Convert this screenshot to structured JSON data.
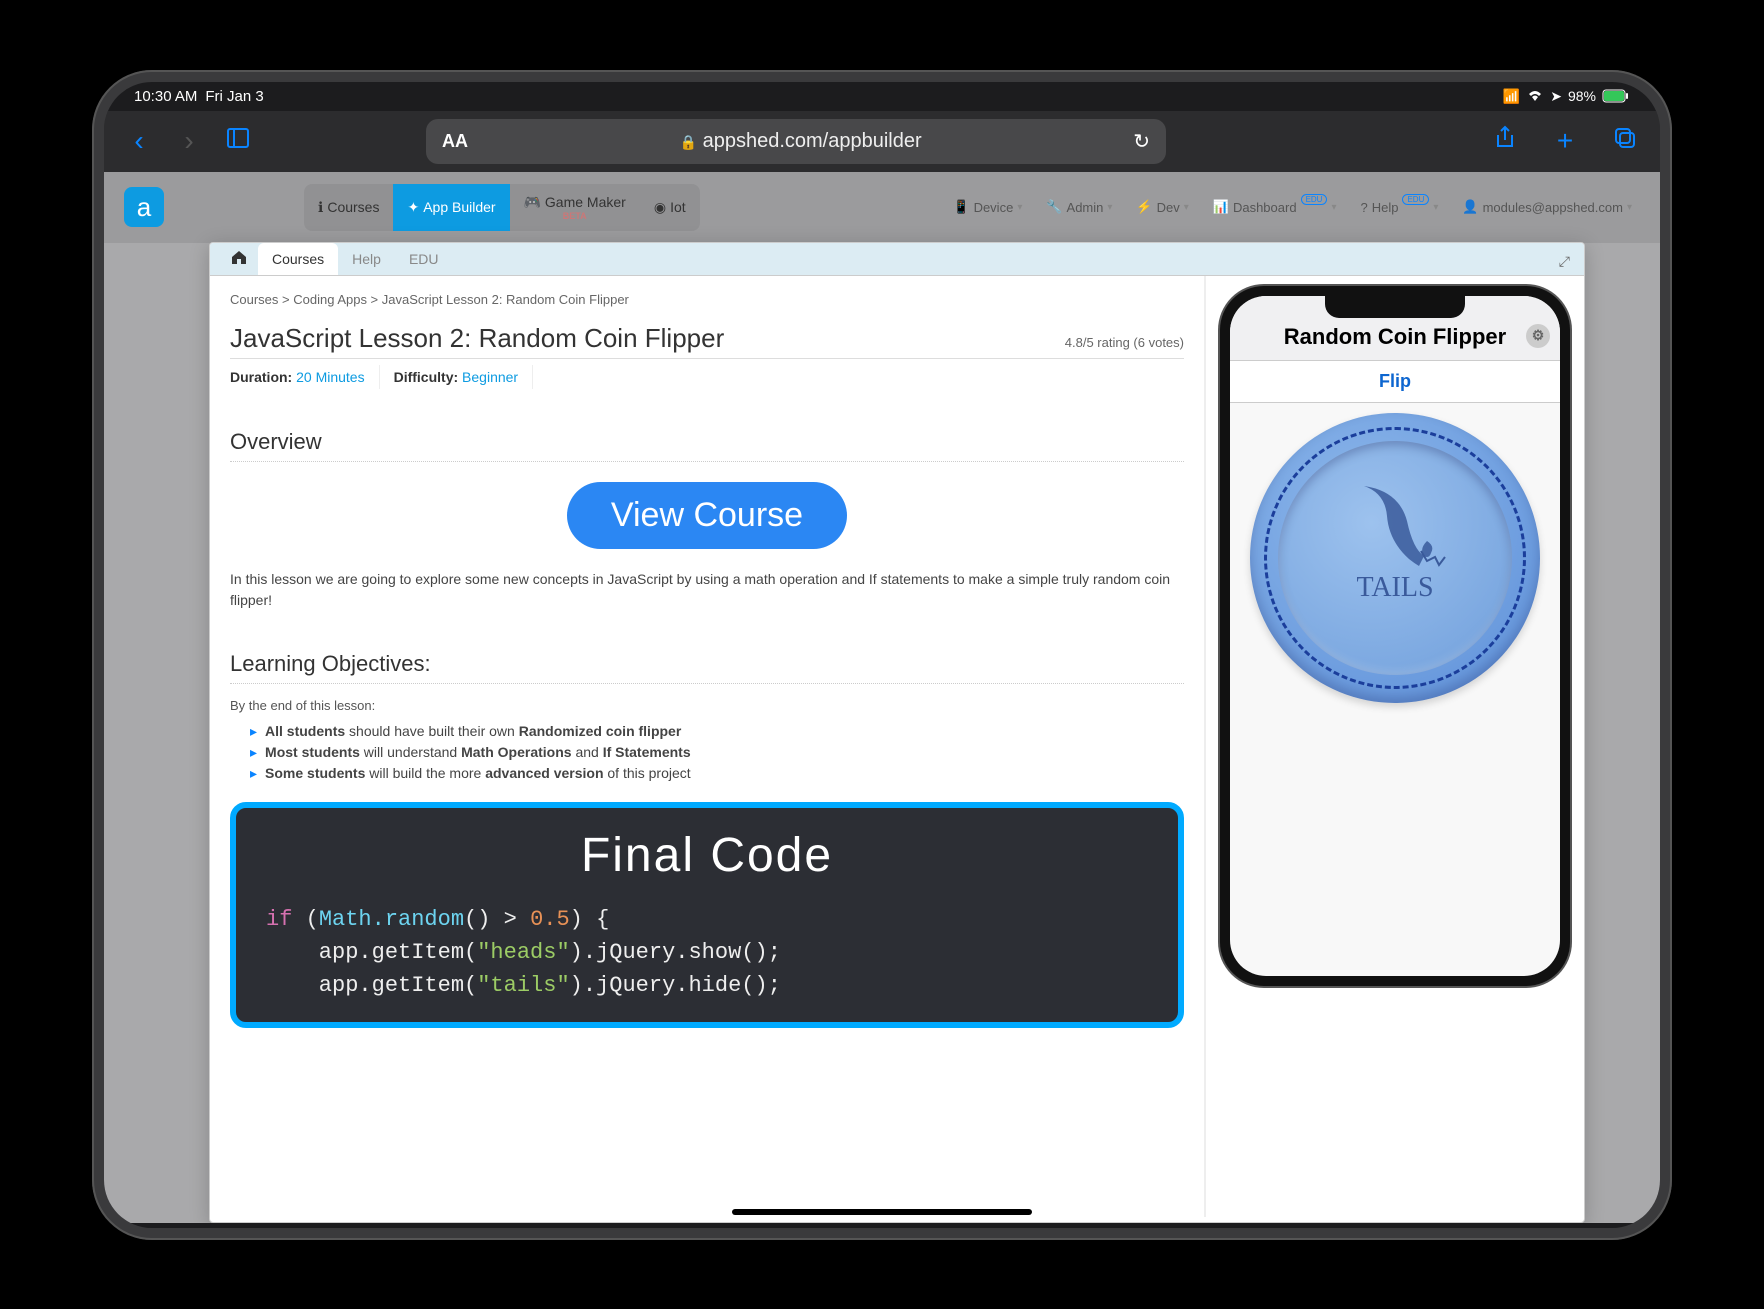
{
  "status": {
    "time": "10:30 AM",
    "date": "Fri Jan 3",
    "battery": "98%"
  },
  "safari": {
    "url": "appshed.com/appbuilder",
    "aa": "AA"
  },
  "topmenu": {
    "courses": "Courses",
    "appbuilder": "App Builder",
    "gamemaker": "Game Maker",
    "gamemaker_beta": "BETA",
    "iot": "Iot",
    "device": "Device",
    "admin": "Admin",
    "dev": "Dev",
    "dashboard": "Dashboard",
    "help": "Help",
    "user": "modules@appshed.com",
    "edu": "EDU"
  },
  "tabs": {
    "courses": "Courses",
    "help": "Help",
    "edu": "EDU"
  },
  "breadcrumb": "Courses > Coding Apps > JavaScript Lesson 2: Random Coin Flipper",
  "title": "JavaScript Lesson 2: Random Coin Flipper",
  "rating": "4.8/5 rating (6 votes)",
  "duration_label": "Duration:",
  "duration_val": "20 Minutes",
  "difficulty_label": "Difficulty:",
  "difficulty_val": "Beginner",
  "overview_h": "Overview",
  "view_course": "View Course",
  "desc": "In this lesson we are going to explore some new concepts in JavaScript by using a math operation and If statements to make a simple truly random coin flipper!",
  "objectives_h": "Learning Objectives:",
  "obj_intro": "By the end of this lesson:",
  "obj1_b": "All students",
  "obj1_t": " should have built their own ",
  "obj1_b2": "Randomized coin flipper",
  "obj2_b": "Most students",
  "obj2_t": " will understand ",
  "obj2_b2": "Math Operations",
  "obj2_t2": " and ",
  "obj2_b3": "If Statements",
  "obj3_b": "Some students",
  "obj3_t": " will build the more ",
  "obj3_b2": "advanced version",
  "obj3_t2": " of this project",
  "final_code": "Final Code",
  "code": {
    "l1_if": "if",
    "l1_mathrand": "Math.random",
    "l1_rest": "() > ",
    "l1_num": "0.5",
    "l1_end": ") {",
    "l2_pre": "    app.getItem(",
    "l2_str": "\"heads\"",
    "l2_post": ").jQuery.show();",
    "l3_pre": "    app.getItem(",
    "l3_str": "\"tails\"",
    "l3_post": ").jQuery.hide();"
  },
  "phone": {
    "title": "Random Coin Flipper",
    "flip": "Flip",
    "coin_label": "TAILS"
  }
}
